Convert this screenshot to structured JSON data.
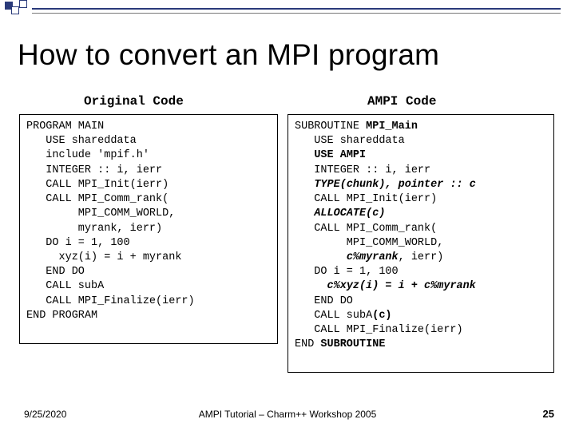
{
  "title": "How to convert an MPI program",
  "headings": {
    "left": "Original Code",
    "right": "AMPI Code"
  },
  "code": {
    "left": [
      {
        "t": "PROGRAM MAIN"
      },
      {
        "t": "   USE shareddata"
      },
      {
        "t": "   include 'mpif.h'"
      },
      {
        "t": "   INTEGER :: i, ierr"
      },
      {
        "t": "   CALL MPI_Init(ierr)"
      },
      {
        "t": "   CALL MPI_Comm_rank("
      },
      {
        "t": "        MPI_COMM_WORLD,"
      },
      {
        "t": "        myrank, ierr)"
      },
      {
        "t": "   DO i = 1, 100"
      },
      {
        "t": "     xyz(i) = i + myrank"
      },
      {
        "t": "   END DO"
      },
      {
        "t": "   CALL subA"
      },
      {
        "t": "   CALL MPI_Finalize(ierr)"
      },
      {
        "t": "END PROGRAM"
      }
    ],
    "right": [
      {
        "pre": "SUBROUTINE ",
        "b": "MPI_Main"
      },
      {
        "t": "   USE shareddata"
      },
      {
        "pre": "   ",
        "b": "USE AMPI"
      },
      {
        "t": "   INTEGER :: i, ierr"
      },
      {
        "pre": "   ",
        "bi": "TYPE(chunk), pointer :: c"
      },
      {
        "t": "   CALL MPI_Init(ierr)"
      },
      {
        "pre": "   ",
        "bi": "ALLOCATE(c)"
      },
      {
        "t": "   CALL MPI_Comm_rank("
      },
      {
        "t": "        MPI_COMM_WORLD,"
      },
      {
        "pre": "        ",
        "bi": "c%myrank",
        "post": ", ierr)"
      },
      {
        "t": "   DO i = 1, 100"
      },
      {
        "pre": "     ",
        "bi": "c%xyz(i) = i + c%myrank"
      },
      {
        "t": "   END DO"
      },
      {
        "pre": "   CALL subA",
        "b": "(c)"
      },
      {
        "t": "   CALL MPI_Finalize(ierr)"
      },
      {
        "pre": "END ",
        "b": "SUBROUTINE"
      }
    ]
  },
  "footer": {
    "date": "9/25/2020",
    "center": "AMPI Tutorial – Charm++ Workshop 2005",
    "page": "25"
  }
}
